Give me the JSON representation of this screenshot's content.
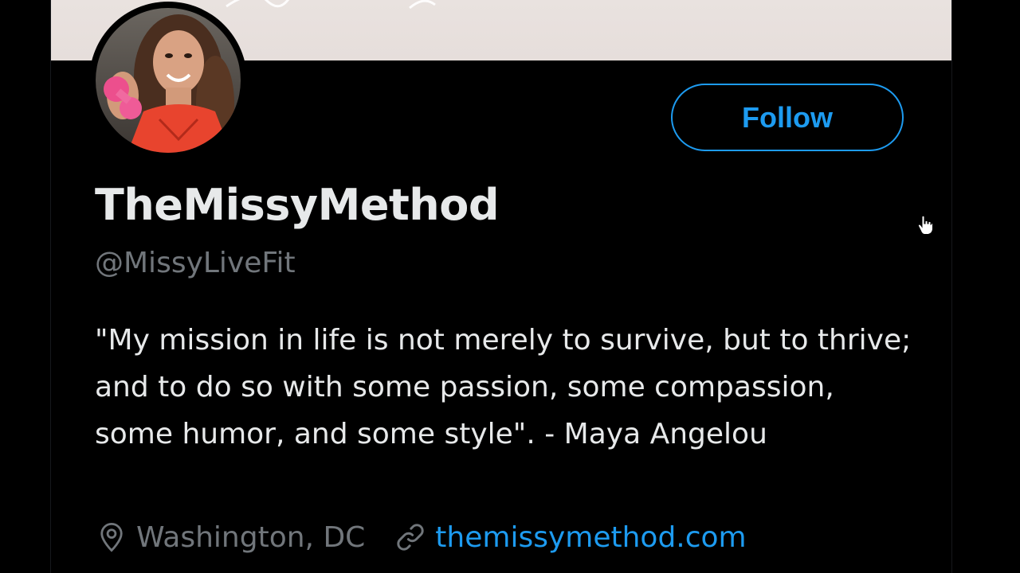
{
  "profile": {
    "display_name": "TheMissyMethod",
    "handle": "@MissyLiveFit",
    "bio": "\"My mission in life is not merely to survive, but to thrive; and to do so with some passion, some compassion, some humor, and some style\". - Maya Angelou",
    "location": "Washington, DC",
    "website": "themissymethod.com"
  },
  "actions": {
    "follow_label": "Follow"
  },
  "icons": {
    "location": "location-pin-icon",
    "link": "link-icon",
    "cursor": "hand-pointer-cursor-icon"
  },
  "colors": {
    "background": "#000000",
    "accent": "#1d9bf0",
    "primary_text": "#e7e9ea",
    "secondary_text": "#71767b",
    "banner": "#e8e1de"
  }
}
